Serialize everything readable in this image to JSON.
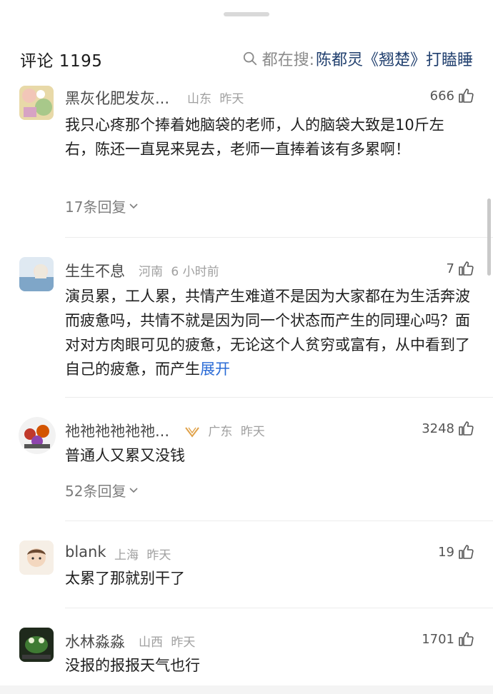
{
  "header": {
    "title": "评论 1195",
    "search_prefix": "都在搜:",
    "search_query": "陈都灵《翘楚》打瞌睡"
  },
  "comments": [
    {
      "username": "黑灰化肥发灰...",
      "location": "山东",
      "time": "昨天",
      "likes": "666",
      "text": "我只心疼那个捧着她脑袋的老师，人的脑袋大致是10斤左右，陈还一直晃来晃去，老师一直捧着该有多累啊！",
      "replies": "17条回复"
    },
    {
      "username": "生生不息",
      "location": "河南",
      "time": "6 小时前",
      "likes": "7",
      "text": "演员累，工人累，共情产生难道不是因为大家都在为生活奔波而疲惫吗，共情不就是因为同一个状态而产生的同理心吗？面对对方肉眼可见的疲惫，无论这个人贫穷或富有，从中看到了自己的疲惫，而产生",
      "expand": "展开"
    },
    {
      "username": "祂祂祂祂祂祂...",
      "location": "广东",
      "time": "昨天",
      "likes": "3248",
      "text": "普通人又累又没钱",
      "replies": "52条回复"
    },
    {
      "username": "blank",
      "location": "上海",
      "time": "昨天",
      "likes": "19",
      "text": "太累了那就别干了"
    },
    {
      "username": "水林淼淼",
      "location": "山西",
      "time": "昨天",
      "likes": "1701",
      "text": "没报的报报天气也行"
    }
  ],
  "colors": {
    "link": "#203f6e",
    "expand": "#2a6bd6",
    "muted": "#a0a0a0"
  }
}
